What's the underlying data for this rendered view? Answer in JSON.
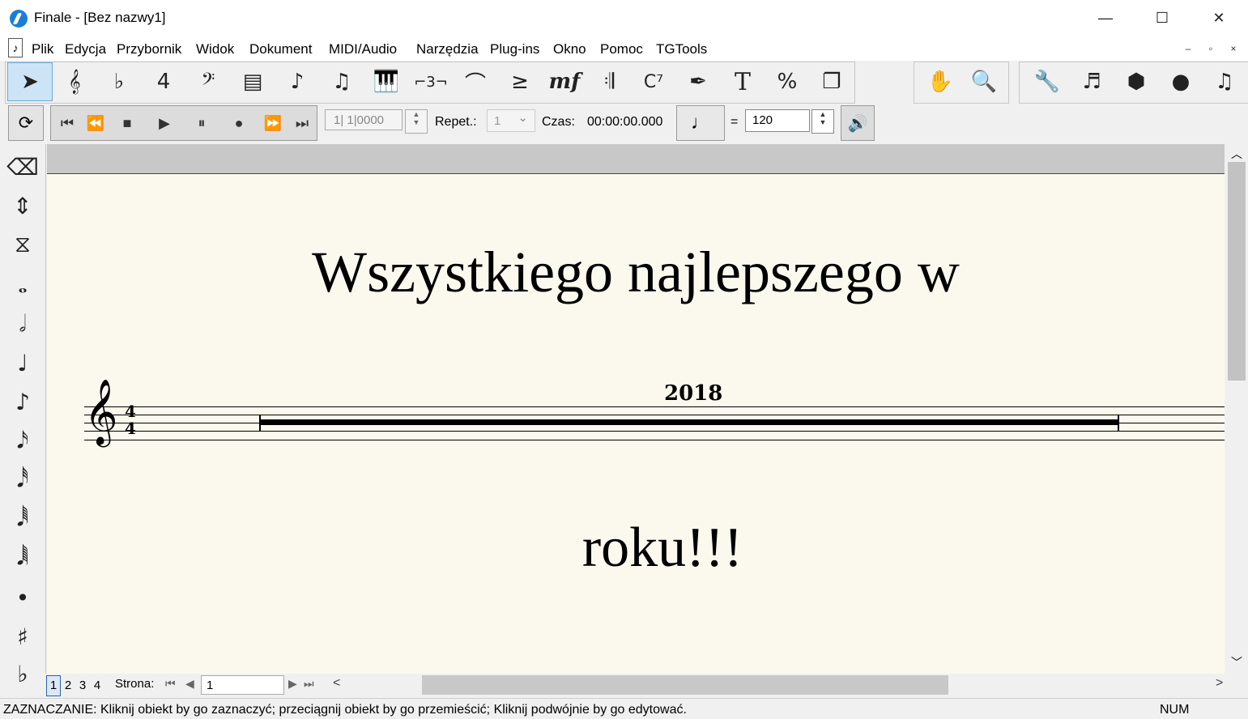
{
  "window": {
    "title": "Finale  - [Bez nazwy1]",
    "minimize_glyph": "—",
    "maximize_glyph": "☐",
    "close_glyph": "✕"
  },
  "menu": {
    "items": [
      "Plik",
      "Edycja",
      "Przybornik",
      "Widok",
      "Dokument",
      "MIDI/Audio",
      "Narzędzia",
      "Plug-ins",
      "Okno",
      "Pomoc",
      "TGTools"
    ],
    "mdi_minimize": "–",
    "mdi_restore": "▫",
    "mdi_close": "×"
  },
  "main_palette": {
    "tools": [
      {
        "name": "selection-tool",
        "glyph": "➤"
      },
      {
        "name": "staff-tool",
        "glyph": "𝄞"
      },
      {
        "name": "key-signature-tool",
        "glyph": "♭"
      },
      {
        "name": "time-signature-tool",
        "glyph": "4"
      },
      {
        "name": "clef-tool",
        "glyph": "𝄢"
      },
      {
        "name": "measure-tool",
        "glyph": "▤"
      },
      {
        "name": "simple-entry-tool",
        "glyph": "♪"
      },
      {
        "name": "speedy-entry-tool",
        "glyph": "♫"
      },
      {
        "name": "hyperscribe-tool",
        "glyph": "🎹"
      },
      {
        "name": "tuplet-tool",
        "glyph": "⌐3¬"
      },
      {
        "name": "smart-shape-tool",
        "glyph": "⌒"
      },
      {
        "name": "articulation-tool",
        "glyph": "≥"
      },
      {
        "name": "expression-tool",
        "glyph": "mf"
      },
      {
        "name": "repeat-tool",
        "glyph": "𝄇"
      },
      {
        "name": "chord-tool",
        "glyph": "C⁷"
      },
      {
        "name": "lyrics-tool",
        "glyph": "✒"
      },
      {
        "name": "text-tool",
        "glyph": "T"
      },
      {
        "name": "resize-tool",
        "glyph": "%"
      },
      {
        "name": "page-layout-tool",
        "glyph": "❐"
      }
    ],
    "adv_tools": [
      {
        "name": "hand-grabber-tool",
        "glyph": "✋"
      },
      {
        "name": "zoom-tool",
        "glyph": "🔍"
      }
    ],
    "util_tools": [
      {
        "name": "special-tools-tool",
        "glyph": "🔧"
      },
      {
        "name": "note-mover-tool",
        "glyph": "♬"
      },
      {
        "name": "mass-edit-tool",
        "glyph": "⬢"
      },
      {
        "name": "midi-tool",
        "glyph": "●"
      },
      {
        "name": "midi-audio-tool",
        "glyph": "♫"
      }
    ]
  },
  "playback": {
    "rewind_glyph": "⟳",
    "transport": [
      {
        "name": "go-to-start-button",
        "glyph": "⏮"
      },
      {
        "name": "rewind-button",
        "glyph": "⏪"
      },
      {
        "name": "stop-button",
        "glyph": "■"
      },
      {
        "name": "play-button",
        "glyph": "▶"
      },
      {
        "name": "pause-button",
        "glyph": "⏸"
      },
      {
        "name": "record-button",
        "glyph": "●"
      },
      {
        "name": "fast-forward-button",
        "glyph": "⏩"
      },
      {
        "name": "go-to-end-button",
        "glyph": "⏭"
      }
    ],
    "counter": "1| 1|0000",
    "repet_label": "Repet.:",
    "repet_value": "1",
    "czas_label": "Czas:",
    "czas_value": "00:00:00.000",
    "tempo_unit_glyph": "♩",
    "equals": "=",
    "tempo": "120",
    "settings_glyph": "🔊"
  },
  "left_palette": [
    {
      "name": "eraser-tool",
      "glyph": "⌫"
    },
    {
      "name": "half-step-tool",
      "glyph": "⇕"
    },
    {
      "name": "tie-tool",
      "glyph": "⧖"
    },
    {
      "name": "whole-note-tool",
      "glyph": "𝅝"
    },
    {
      "name": "half-note-tool",
      "glyph": "𝅗𝅥"
    },
    {
      "name": "quarter-note-tool",
      "glyph": "♩"
    },
    {
      "name": "eighth-note-tool",
      "glyph": "♪"
    },
    {
      "name": "sixteenth-note-tool",
      "glyph": "𝅘𝅥𝅯"
    },
    {
      "name": "thirty-second-note-tool",
      "glyph": "𝅘𝅥𝅰"
    },
    {
      "name": "sixty-fourth-note-tool",
      "glyph": "𝅘𝅥𝅱"
    },
    {
      "name": "one-twenty-eighth-note-tool",
      "glyph": "𝅘𝅥𝅲"
    },
    {
      "name": "dot-tool",
      "glyph": "•"
    },
    {
      "name": "sharp-tool",
      "glyph": "♯"
    },
    {
      "name": "flat-tool",
      "glyph": "♭"
    }
  ],
  "score": {
    "title": "Wszystkiego najlepszego w",
    "measure_number": "2018",
    "lyric": "roku!!!",
    "clef_glyph": "𝄞",
    "time_sig_top": "4",
    "time_sig_bottom": "4"
  },
  "pagenav": {
    "pages": [
      "1",
      "2",
      "3",
      "4"
    ],
    "active_page": "1",
    "strona_label": "Strona:",
    "page_value": "1"
  },
  "status": {
    "text": "ZAZNACZANIE: Kliknij obiekt by go zaznaczyć; przeciągnij obiekt by go przemieścić; Kliknij podwójnie by go edytować.",
    "num": "NUM"
  }
}
